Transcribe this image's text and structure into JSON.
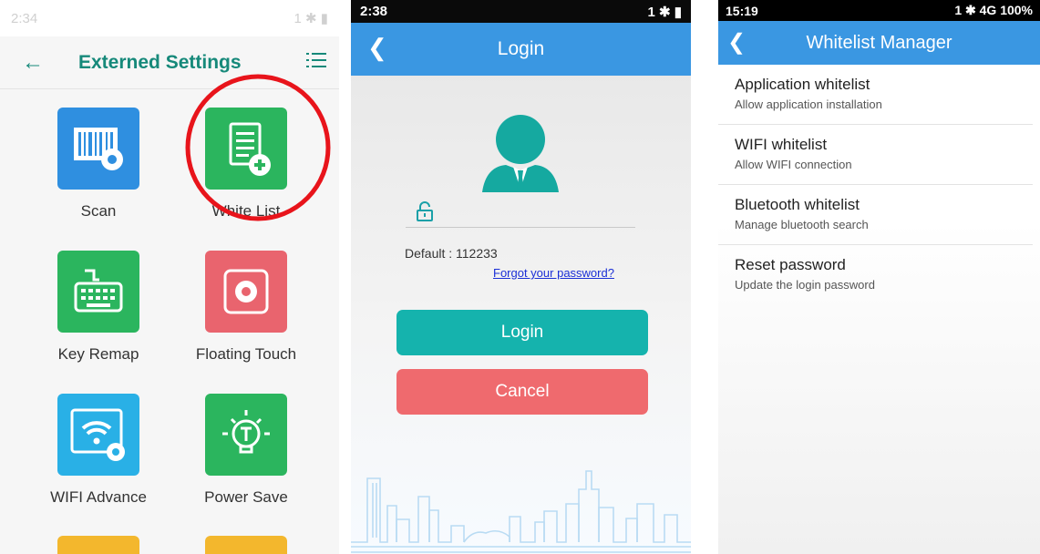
{
  "panel1": {
    "status": {
      "time": "2:34",
      "right": "1 ✱ ▮"
    },
    "title": "Externed Settings",
    "tiles": [
      {
        "label": "Scan"
      },
      {
        "label": "White List"
      },
      {
        "label": "Key Remap"
      },
      {
        "label": "Floating Touch"
      },
      {
        "label": "WIFI Advance"
      },
      {
        "label": "Power Save"
      }
    ],
    "colors": {
      "accent": "#16897a",
      "highlight_circle": "#e8141b"
    }
  },
  "panel2": {
    "status": {
      "time": "2:38",
      "right": "1 ✱ ▮"
    },
    "title": "Login",
    "default_text": "Default : 112233",
    "forgot_link": "Forgot your password?",
    "login_button": "Login",
    "cancel_button": "Cancel",
    "colors": {
      "appbar": "#3a97e2",
      "login": "#15b3ad",
      "cancel": "#ef6a6e",
      "avatar": "#15a9a0"
    }
  },
  "panel3": {
    "status": {
      "time": "15:19",
      "right": "1 ✱ 4G 100%"
    },
    "title": "Whitelist Manager",
    "items": [
      {
        "title": "Application whitelist",
        "subtitle": "Allow application installation"
      },
      {
        "title": "WIFI whitelist",
        "subtitle": "Allow WIFI connection"
      },
      {
        "title": "Bluetooth whitelist",
        "subtitle": "Manage bluetooth search"
      },
      {
        "title": "Reset password",
        "subtitle": "Update the login password"
      }
    ]
  }
}
